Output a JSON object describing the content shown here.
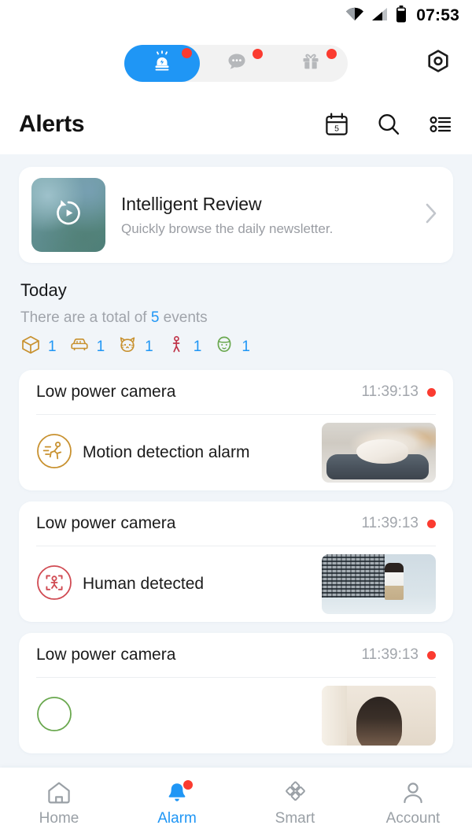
{
  "status_bar": {
    "time": "07:53",
    "icons": [
      "wifi-icon",
      "cellular-signal-icon",
      "battery-icon"
    ]
  },
  "top_tabs": {
    "items": [
      {
        "name": "alarm",
        "icon": "siren-icon",
        "active": true,
        "badge": true
      },
      {
        "name": "messages",
        "icon": "chat-bubble-icon",
        "active": false,
        "badge": true
      },
      {
        "name": "gifts",
        "icon": "gift-icon",
        "active": false,
        "badge": true
      }
    ],
    "settings_icon": "hexagon-gear-icon",
    "active_color": "#1f96f5",
    "badge_color": "#fb3b30"
  },
  "header": {
    "title": "Alerts",
    "actions": [
      {
        "name": "calendar",
        "icon": "calendar-icon",
        "day": "5"
      },
      {
        "name": "search",
        "icon": "search-icon"
      },
      {
        "name": "filter",
        "icon": "filter-list-icon"
      }
    ]
  },
  "review_card": {
    "title": "Intelligent Review",
    "subtitle": "Quickly browse the daily newsletter.",
    "thumbnail_icon": "replay-play-icon",
    "chevron_icon": "chevron-right-icon"
  },
  "today": {
    "heading": "Today",
    "summary_prefix": "There are a total of ",
    "summary_count": "5",
    "summary_suffix": " events",
    "count_color": "#1f96f5",
    "chips": [
      {
        "icon": "package-box-icon",
        "color": "#c8912f",
        "count": "1"
      },
      {
        "icon": "car-icon",
        "color": "#c8912f",
        "count": "1"
      },
      {
        "icon": "cat-face-icon",
        "color": "#c8912f",
        "count": "1"
      },
      {
        "icon": "person-walking-icon",
        "color": "#c0354a",
        "count": "1"
      },
      {
        "icon": "face-head-icon",
        "color": "#6aa84f",
        "count": "1"
      }
    ]
  },
  "events": [
    {
      "device": "Low power camera",
      "time": "11:39:13",
      "unread": true,
      "alert_label": "Motion detection alarm",
      "alert_icon": "motion-running-icon",
      "alert_color": "#c8912f",
      "thumbnail": "cat-on-cushion-photo"
    },
    {
      "device": "Low power camera",
      "time": "11:39:13",
      "unread": true,
      "alert_label": "Human detected",
      "alert_icon": "human-detection-icon",
      "alert_color": "#d04a52",
      "thumbnail": "man-by-fence-photo"
    },
    {
      "device": "Low power camera",
      "time": "11:39:13",
      "unread": true,
      "alert_label": "",
      "alert_icon": "face-detection-icon",
      "alert_color": "#6aa84f",
      "thumbnail": "person-face-photo"
    }
  ],
  "bottom_nav": {
    "items": [
      {
        "label": "Home",
        "icon": "home-icon",
        "active": false,
        "badge": false
      },
      {
        "label": "Alarm",
        "icon": "bell-icon",
        "active": true,
        "badge": true
      },
      {
        "label": "Smart",
        "icon": "diamonds-icon",
        "active": false,
        "badge": false
      },
      {
        "label": "Account",
        "icon": "person-icon",
        "active": false,
        "badge": false
      }
    ],
    "active_color": "#1f96f5",
    "inactive_color": "#9aa0a6"
  }
}
